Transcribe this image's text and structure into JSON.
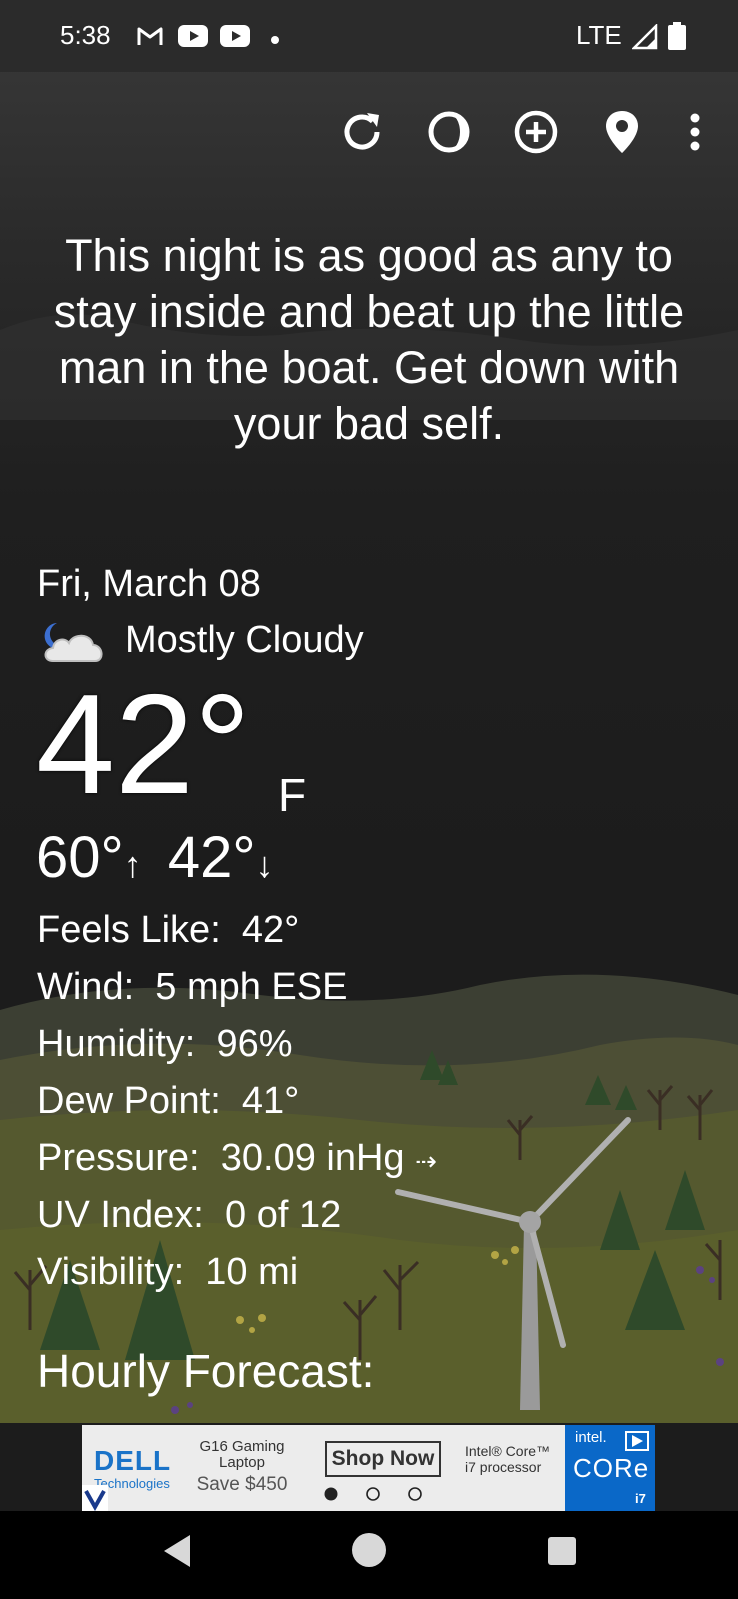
{
  "status_bar": {
    "time": "5:38",
    "notification_icons": [
      "gmail-icon",
      "youtube-icon",
      "youtube-icon",
      "dot-icon"
    ],
    "network": "LTE",
    "signal_icon": "signal-icon",
    "battery_icon": "battery-icon"
  },
  "toolbar": {
    "icons": [
      "refresh-icon",
      "moon-phase-icon",
      "add-location-icon",
      "location-pin-icon",
      "more-vert-icon"
    ]
  },
  "message": "This night is as good as any to stay inside and beat up the little man in the boat. Get down with your bad self.",
  "weather": {
    "date": "Fri, March 08",
    "condition_icon": "night-cloudy-icon",
    "condition": "Mostly Cloudy",
    "temperature": "42°",
    "unit": "F",
    "high": "60°",
    "high_arrow": "↑",
    "low": "42°",
    "low_arrow": "↓",
    "details": [
      {
        "label": "Feels Like:",
        "value": "42°"
      },
      {
        "label": "Wind:",
        "value": "5 mph ESE"
      },
      {
        "label": "Humidity:",
        "value": "96%"
      },
      {
        "label": "Dew Point:",
        "value": "41°"
      },
      {
        "label": "Pressure:",
        "value": "30.09 inHg",
        "trend": "⇢"
      },
      {
        "label": "UV Index:",
        "value": "0 of 12"
      },
      {
        "label": "Visibility:",
        "value": "10 mi"
      }
    ]
  },
  "hourly_heading": "Hourly Forecast:",
  "ad": {
    "brand": "DELL",
    "brand_sub": "Technologies",
    "product": "G16 Gaming Laptop",
    "offer": "Save $450",
    "cta": "Shop Now",
    "processor": "Intel® Core™ i7 processor",
    "badge_top": "intel.",
    "badge_main": "CORe",
    "badge_bottom": "i7"
  },
  "nav_bar": {
    "icons": [
      "back-icon",
      "home-icon",
      "recents-icon"
    ]
  }
}
